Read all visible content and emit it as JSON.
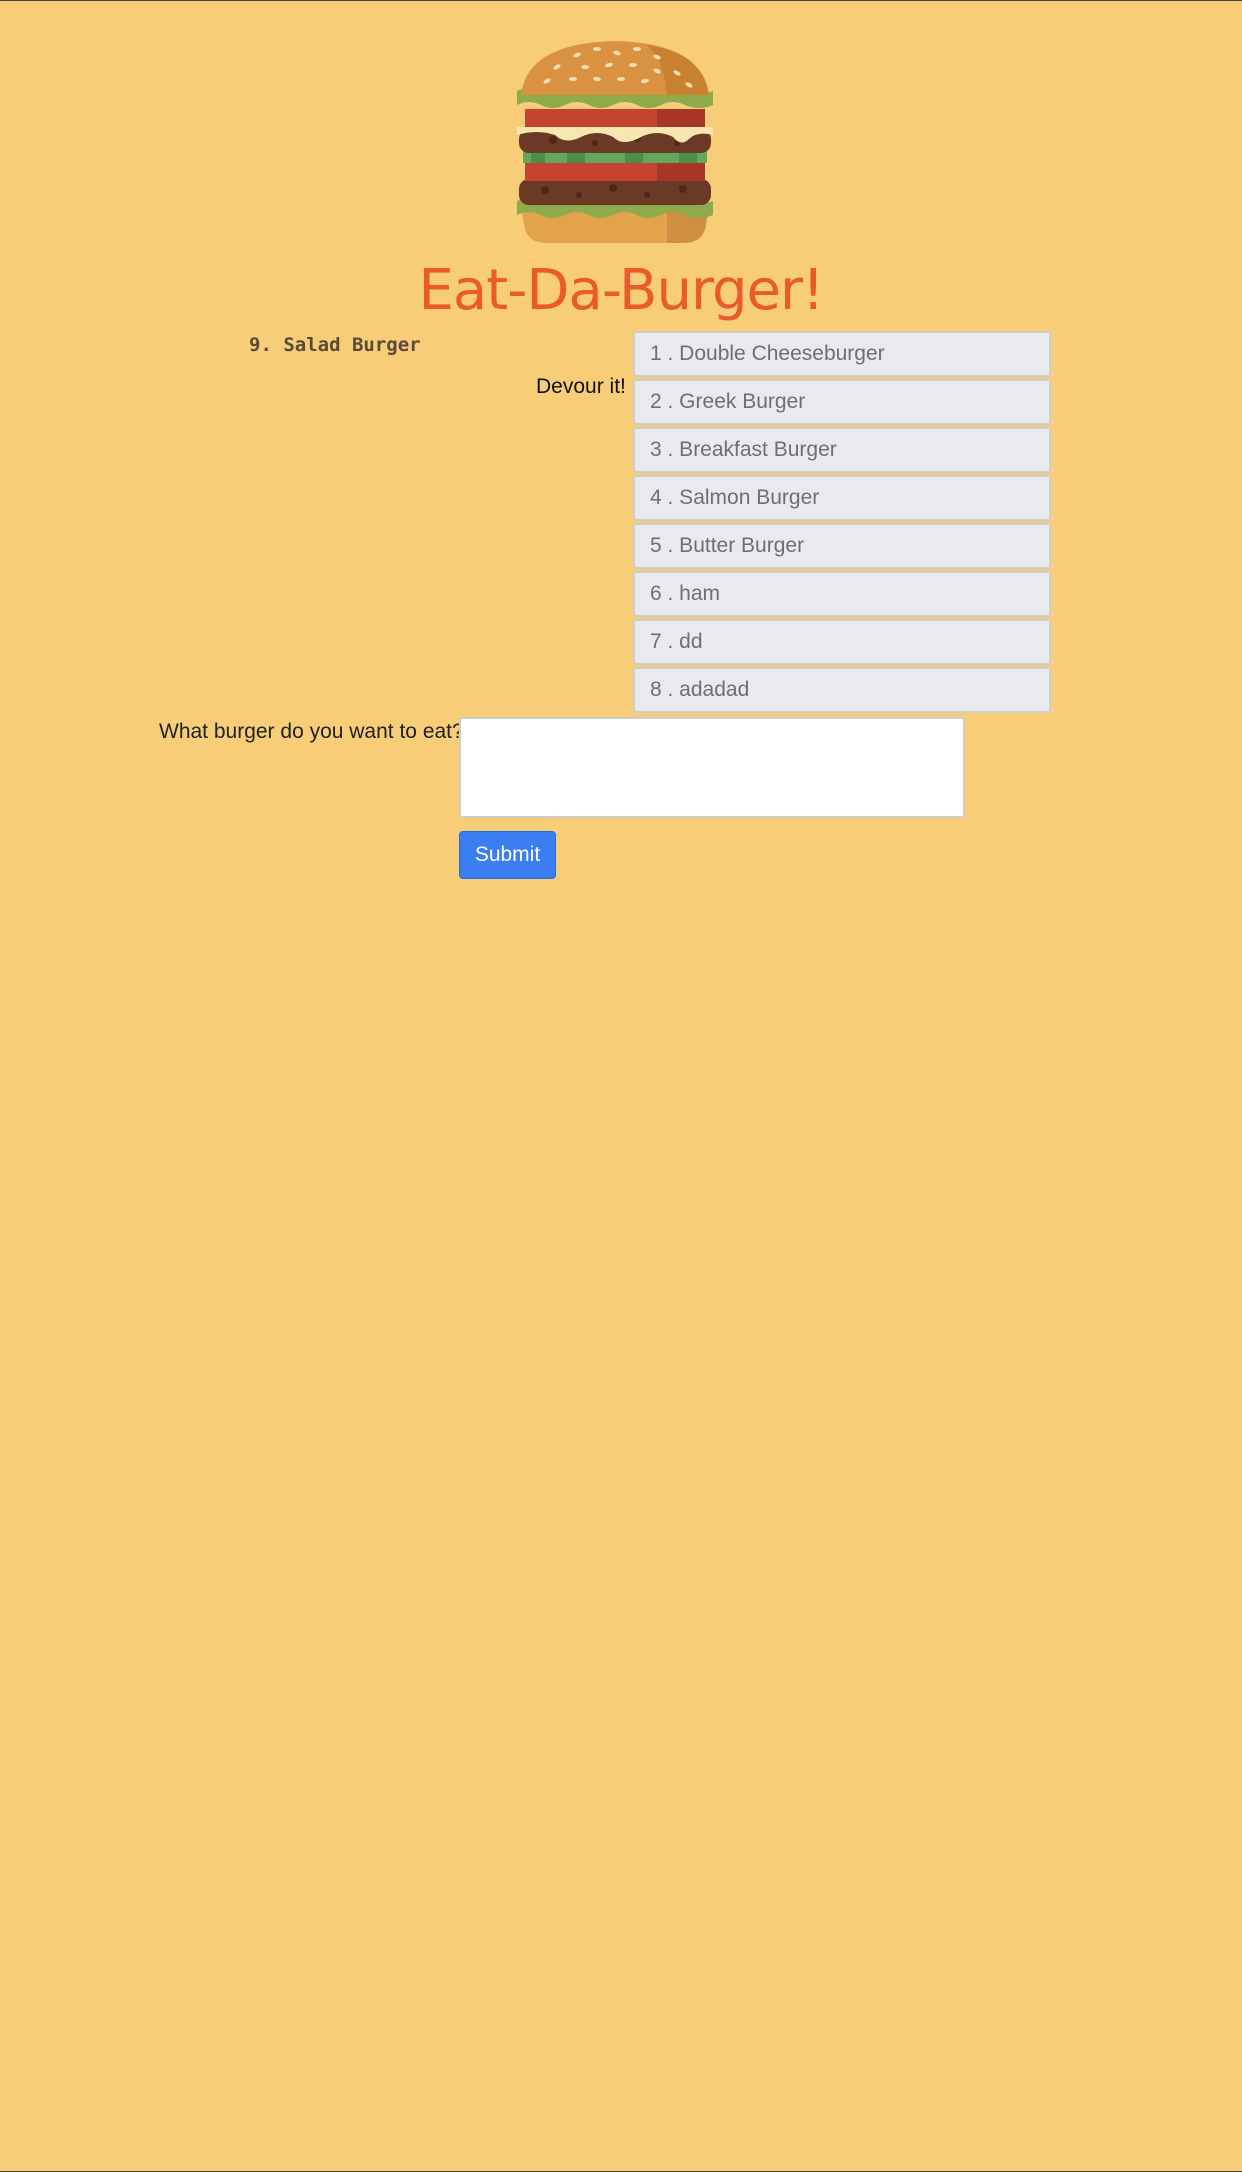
{
  "header": {
    "logo_icon": "burger-icon",
    "title": "Eat-Da-Burger!"
  },
  "devoured": {
    "items": [
      "9. Salad Burger"
    ]
  },
  "devour_label": "Devour it!",
  "burgers": [
    "1 . Double Cheeseburger",
    "2 . Greek Burger",
    "3 . Breakfast Burger",
    "4 . Salmon Burger",
    "5 . Butter Burger",
    "6 . ham",
    "7 . dd",
    "8 . adadad"
  ],
  "form": {
    "label": "What burger do you want to eat?",
    "value": "",
    "submit_label": "Submit"
  },
  "colors": {
    "background": "#f7cd78",
    "title": "#ea5a2c",
    "submit": "#3b7ef1"
  }
}
